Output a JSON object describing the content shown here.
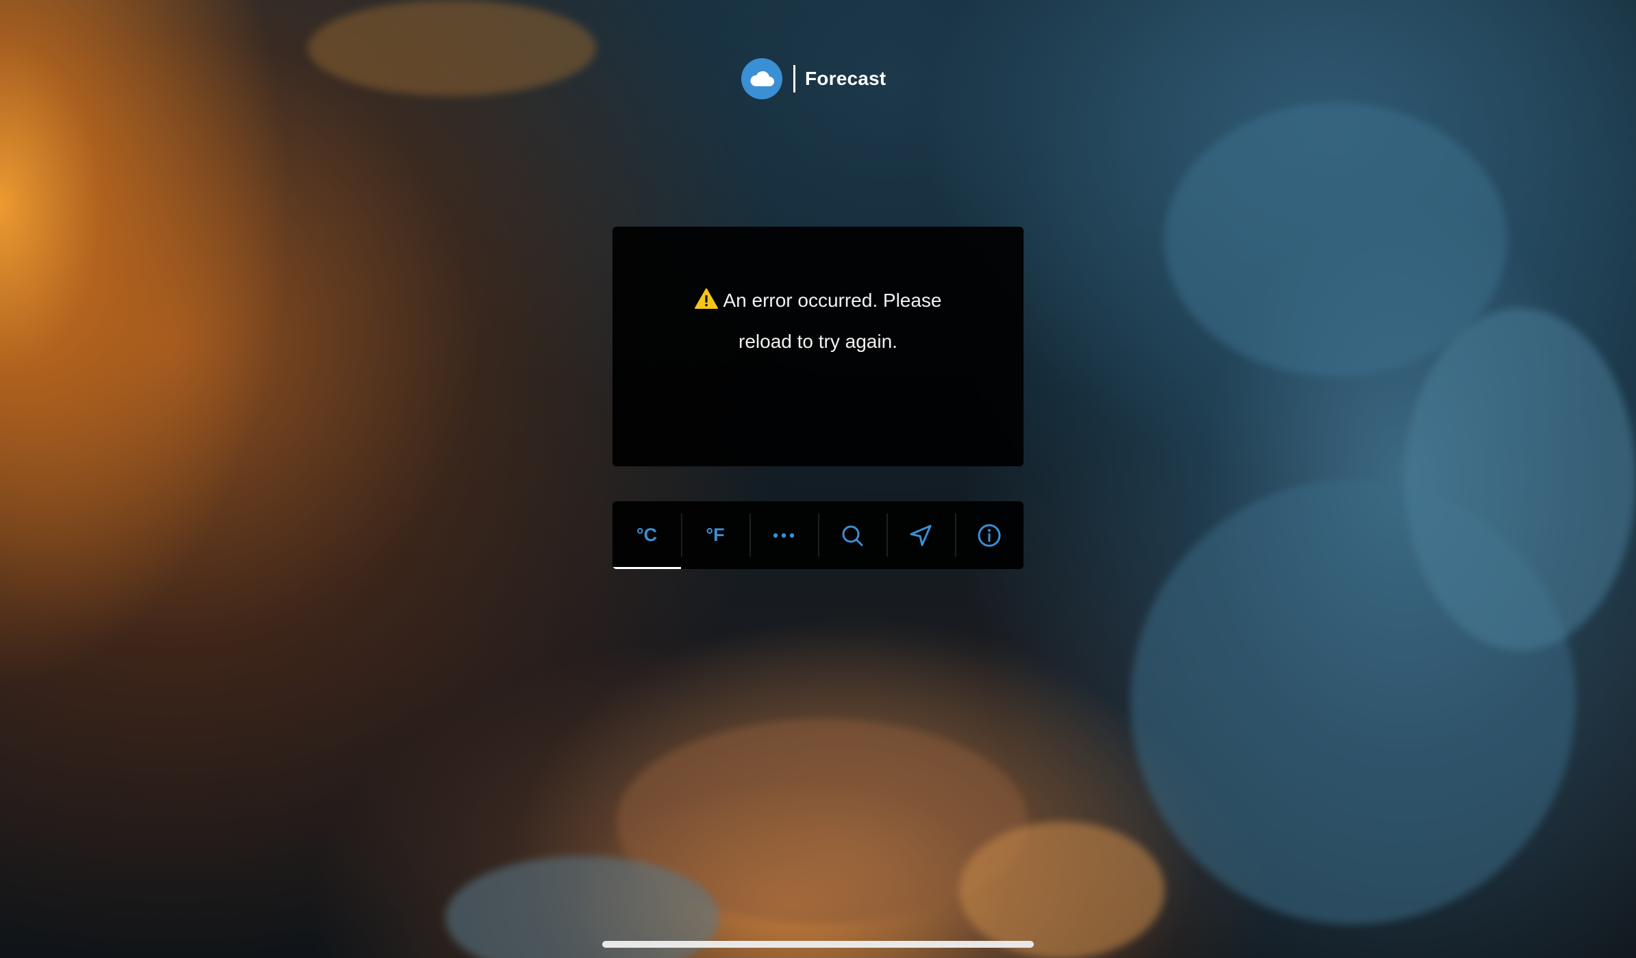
{
  "header": {
    "logo_icon": "cloud-icon",
    "title": "Forecast"
  },
  "error": {
    "icon": "warning-icon",
    "message": "An error occurred. Please reload to try again."
  },
  "toolbar": {
    "items": [
      {
        "label": "°C",
        "icon": null,
        "active": true
      },
      {
        "label": "°F",
        "icon": null,
        "active": false
      },
      {
        "label": "",
        "icon": "more-icon",
        "active": false
      },
      {
        "label": "",
        "icon": "search-icon",
        "active": false
      },
      {
        "label": "",
        "icon": "location-arrow-icon",
        "active": false
      },
      {
        "label": "",
        "icon": "info-icon",
        "active": false
      }
    ]
  },
  "colors": {
    "accent": "#3b8fd4",
    "card_background": "#000000",
    "warning": "#f5c518"
  }
}
